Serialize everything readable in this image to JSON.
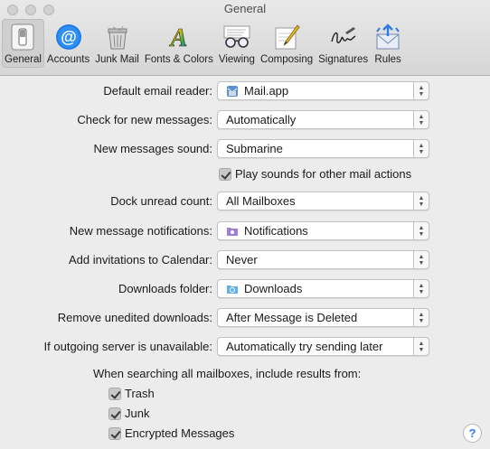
{
  "window": {
    "title": "General"
  },
  "toolbar": {
    "items": [
      {
        "label": "General",
        "icon": "switch-icon",
        "selected": true
      },
      {
        "label": "Accounts",
        "icon": "at-sign-icon"
      },
      {
        "label": "Junk Mail",
        "icon": "trash-bin-icon"
      },
      {
        "label": "Fonts & Colors",
        "icon": "font-colors-icon"
      },
      {
        "label": "Viewing",
        "icon": "glasses-icon"
      },
      {
        "label": "Composing",
        "icon": "pencil-icon"
      },
      {
        "label": "Signatures",
        "icon": "signature-icon"
      },
      {
        "label": "Rules",
        "icon": "rules-envelope-icon"
      }
    ]
  },
  "settings": {
    "default_reader": {
      "label": "Default email reader:",
      "value": "Mail.app",
      "icon": "mail-app-icon"
    },
    "check_new": {
      "label": "Check for new messages:",
      "value": "Automatically"
    },
    "new_sound": {
      "label": "New messages sound:",
      "value": "Submarine"
    },
    "play_sounds": {
      "label": "Play sounds for other mail actions",
      "checked": true
    },
    "dock_unread": {
      "label": "Dock unread count:",
      "value": "All Mailboxes"
    },
    "notifications": {
      "label": "New message notifications:",
      "value": "Notifications",
      "icon": "notifications-folder-icon"
    },
    "invitations": {
      "label": "Add invitations to Calendar:",
      "value": "Never"
    },
    "downloads_folder": {
      "label": "Downloads folder:",
      "value": "Downloads",
      "icon": "downloads-folder-icon"
    },
    "remove_unedited": {
      "label": "Remove unedited downloads:",
      "value": "After Message is Deleted"
    },
    "outgoing_unavailable": {
      "label": "If outgoing server is unavailable:",
      "value": "Automatically try sending later"
    }
  },
  "search": {
    "heading": "When searching all mailboxes, include results from:",
    "options": [
      {
        "label": "Trash",
        "checked": true
      },
      {
        "label": "Junk",
        "checked": true
      },
      {
        "label": "Encrypted Messages",
        "checked": true
      }
    ]
  },
  "help": {
    "label": "?"
  },
  "colors": {
    "accent": "#3478f6",
    "window_bg": "#ececec"
  }
}
